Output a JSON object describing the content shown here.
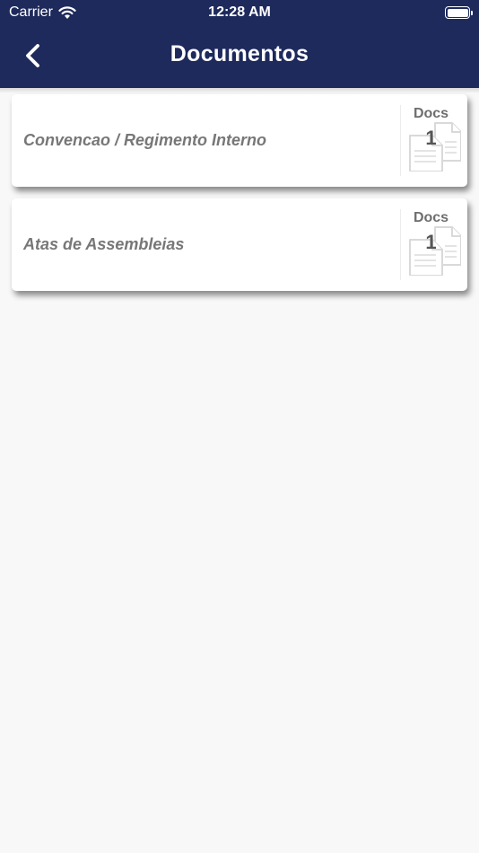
{
  "status_bar": {
    "carrier": "Carrier",
    "time": "12:28 AM",
    "wifi_icon": "wifi-icon",
    "battery_icon": "battery-full-icon"
  },
  "nav": {
    "title": "Documentos",
    "back_icon": "chevron-left-icon"
  },
  "colors": {
    "header_background": "#1e2a5c",
    "page_background": "#f8f8f8",
    "card_background": "#ffffff",
    "item_text": "#777777"
  },
  "documents": [
    {
      "name": "Convencao / Regimento Interno",
      "count_label": "Docs",
      "count": "1",
      "icon": "documents-icon"
    },
    {
      "name": "Atas de Assembleias",
      "count_label": "Docs",
      "count": "1",
      "icon": "documents-icon"
    }
  ]
}
